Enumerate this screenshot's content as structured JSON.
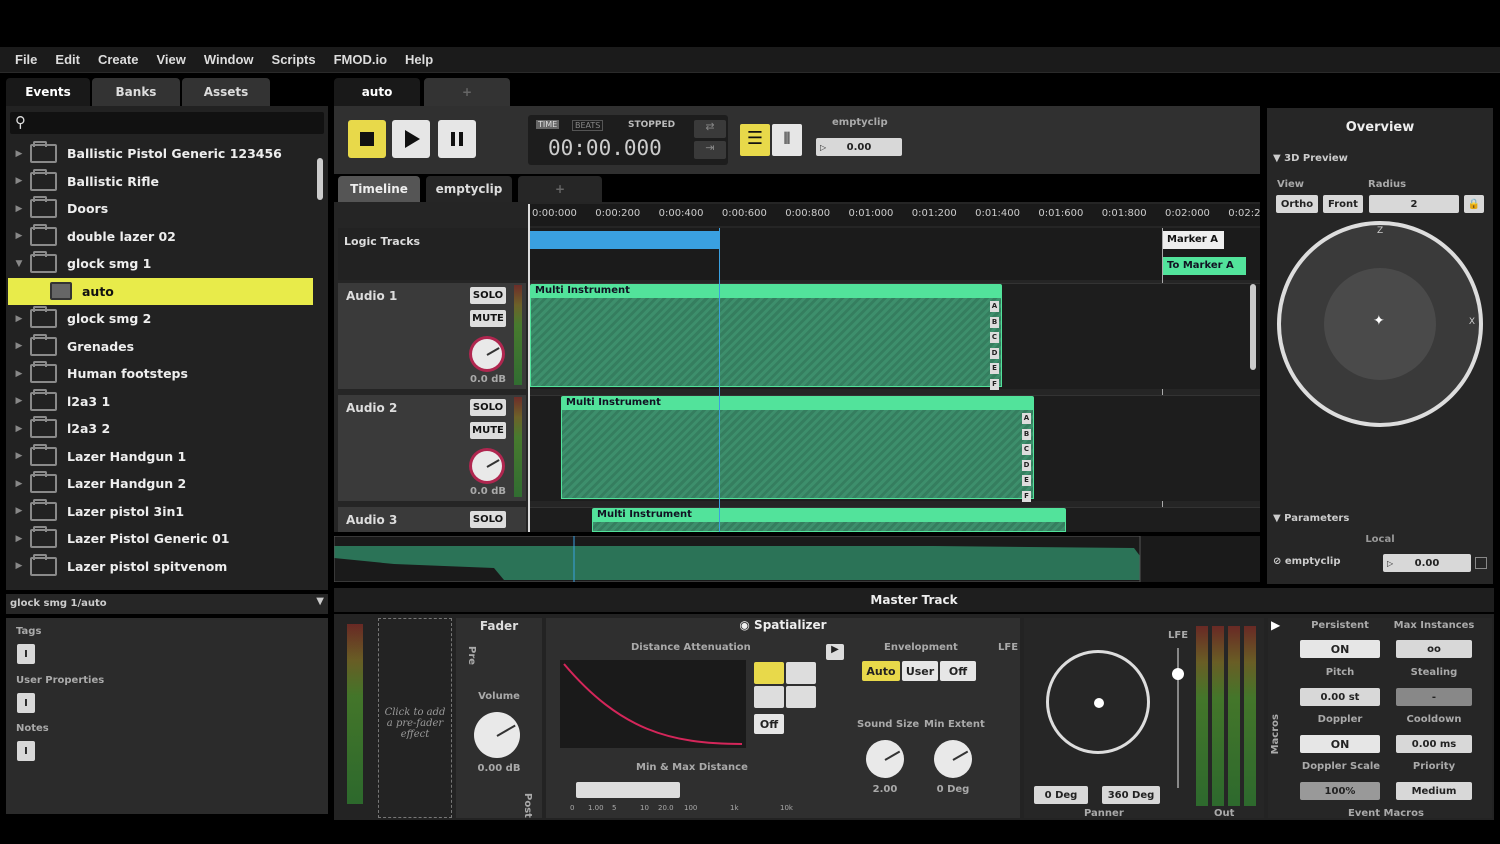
{
  "menu": [
    "File",
    "Edit",
    "Create",
    "View",
    "Window",
    "Scripts",
    "FMOD.io",
    "Help"
  ],
  "browser_tabs": [
    "Events",
    "Banks",
    "Assets"
  ],
  "events": [
    {
      "label": "Ballistic Pistol Generic 123456",
      "type": "folder",
      "expanded": false
    },
    {
      "label": "Ballistic Rifle",
      "type": "folder",
      "expanded": false
    },
    {
      "label": "Doors",
      "type": "folder",
      "expanded": false
    },
    {
      "label": "double lazer 02",
      "type": "folder",
      "expanded": false
    },
    {
      "label": "glock smg 1",
      "type": "folder",
      "expanded": true
    },
    {
      "label": "auto",
      "type": "event",
      "selected": true
    },
    {
      "label": "glock smg 2",
      "type": "folder",
      "expanded": false
    },
    {
      "label": "Grenades",
      "type": "folder",
      "expanded": false
    },
    {
      "label": "Human footsteps",
      "type": "folder",
      "expanded": false
    },
    {
      "label": "l2a3 1",
      "type": "folder",
      "expanded": false
    },
    {
      "label": "l2a3 2",
      "type": "folder",
      "expanded": false
    },
    {
      "label": "Lazer Handgun 1",
      "type": "folder",
      "expanded": false
    },
    {
      "label": "Lazer Handgun 2",
      "type": "folder",
      "expanded": false
    },
    {
      "label": "Lazer pistol 3in1",
      "type": "folder",
      "expanded": false
    },
    {
      "label": "Lazer Pistol Generic 01",
      "type": "folder",
      "expanded": false
    },
    {
      "label": "Lazer pistol spitvenom",
      "type": "folder",
      "expanded": false
    }
  ],
  "path": "glock smg 1/auto",
  "info_labels": {
    "tags": "Tags",
    "user_props": "User Properties",
    "notes": "Notes"
  },
  "editor_tabs": {
    "active": "auto",
    "add": "+"
  },
  "transport": {
    "time_label": "TIME",
    "beats_label": "BEATS",
    "state": "STOPPED",
    "time": "00:00.000",
    "clip_label": "emptyclip",
    "clip_value": "0.00"
  },
  "subtabs": [
    "Timeline",
    "emptyclip",
    "+"
  ],
  "ruler": [
    "0:00:000",
    "0:00:200",
    "0:00:400",
    "0:00:600",
    "0:00:800",
    "0:01:000",
    "0:01:200",
    "0:01:400",
    "0:01:600",
    "0:01:800",
    "0:02:000",
    "0:02:2"
  ],
  "logic_tracks_label": "Logic Tracks",
  "markers": {
    "marker": "Marker A",
    "transition": "To Marker A"
  },
  "tracks": [
    {
      "name": "Audio 1",
      "solo": "SOLO",
      "mute": "MUTE",
      "gain": "0.0 dB",
      "clip": "Multi Instrument"
    },
    {
      "name": "Audio 2",
      "solo": "SOLO",
      "mute": "MUTE",
      "gain": "0.0 dB",
      "clip": "Multi Instrument"
    },
    {
      "name": "Audio 3",
      "solo": "SOLO",
      "clip": "Multi Instrument"
    }
  ],
  "clip_letters": [
    "A",
    "B",
    "C",
    "D",
    "E",
    "F"
  ],
  "overview": {
    "title": "Overview",
    "preview": "3D Preview",
    "view_label": "View",
    "radius_label": "Radius",
    "ortho": "Ortho",
    "front": "Front",
    "radius": "2",
    "axis_z": "Z",
    "axis_x": "X"
  },
  "parameters": {
    "title": "Parameters",
    "local": "Local",
    "param": "emptyclip",
    "value": "0.00"
  },
  "master": {
    "title": "Master Track",
    "fader": "Fader",
    "pre": "Pre",
    "post": "Post",
    "prefader_hint": "Click to add a pre-fader effect",
    "volume_label": "Volume",
    "volume": "0.00 dB",
    "spatializer": "Spatializer",
    "distance_attenuation": "Distance Attenuation",
    "envelopment": "Envelopment",
    "env_auto": "Auto",
    "env_user": "User",
    "env_off": "Off",
    "curve_off": "Off",
    "lfe": "LFE",
    "sound_size_label": "Sound Size",
    "min_extent_label": "Min Extent",
    "sound_size": "2.00",
    "min_extent": "0 Deg",
    "min_max_distance": "Min & Max Distance",
    "scale": [
      "0",
      "1.00",
      "5",
      "10",
      "20.0",
      "100",
      "1k",
      "10k"
    ],
    "extent_min": "0 Deg",
    "extent_max": "360 Deg",
    "panner": "Panner",
    "out": "Out"
  },
  "macros": {
    "title": "Macros",
    "persistent_label": "Persistent",
    "persistent": "ON",
    "max_instances_label": "Max Instances",
    "max_instances": "oo",
    "pitch_label": "Pitch",
    "pitch": "0.00 st",
    "stealing_label": "Stealing",
    "stealing": "-",
    "doppler_label": "Doppler",
    "doppler": "ON",
    "cooldown_label": "Cooldown",
    "cooldown": "0.00 ms",
    "doppler_scale_label": "Doppler Scale",
    "doppler_scale": "100%",
    "priority_label": "Priority",
    "priority": "Medium",
    "event_macros": "Event Macros"
  },
  "colors": {
    "accent_yellow": "#e8eb4a",
    "clip_green": "#52e39b",
    "loop_blue": "#3aa0e0"
  }
}
